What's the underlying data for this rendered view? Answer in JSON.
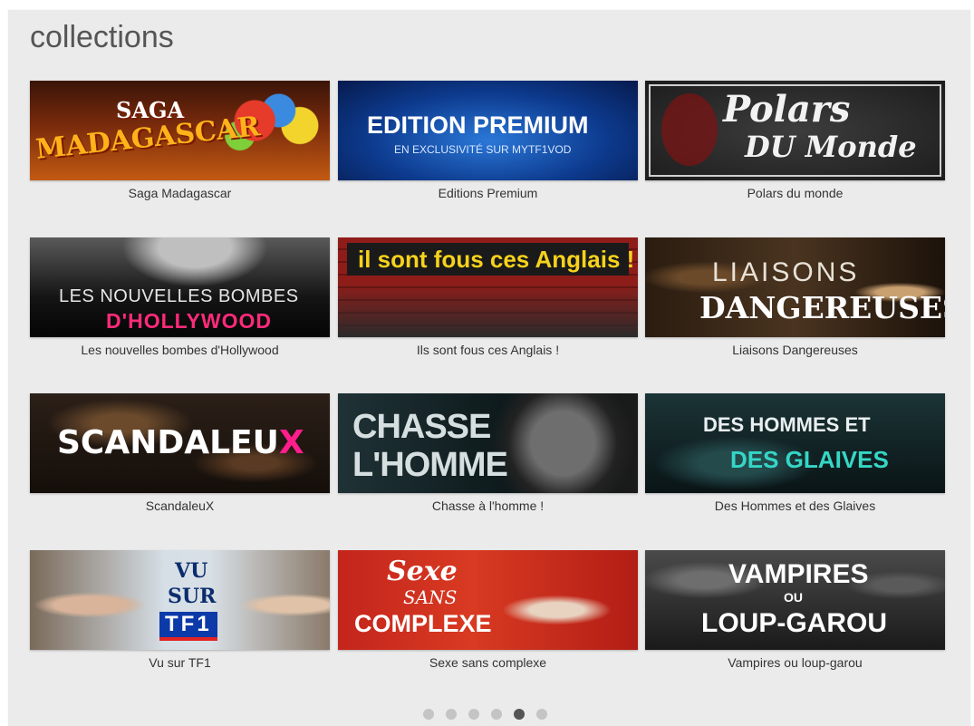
{
  "page": {
    "title": "collections"
  },
  "collections": [
    {
      "caption": "Saga Madagascar",
      "banner_lines": [
        "SAGA",
        "MADAGASCAR"
      ]
    },
    {
      "caption": "Editions Premium",
      "banner_lines": [
        "EDITION PREMIUM",
        "EN EXCLUSIVITÉ SUR MYTF1VOD"
      ]
    },
    {
      "caption": "Polars du monde",
      "banner_lines": [
        "Polars",
        "DU Monde"
      ]
    },
    {
      "caption": "Les nouvelles bombes d'Hollywood",
      "banner_lines": [
        "LES NOUVELLES BOMBES",
        "D'HOLLYWOOD"
      ]
    },
    {
      "caption": "Ils sont fous ces Anglais !",
      "banner_lines": [
        "il sont fous ces Anglais !"
      ]
    },
    {
      "caption": "Liaisons Dangereuses",
      "banner_lines": [
        "LIAISONS",
        "DANGEREUSES"
      ]
    },
    {
      "caption": "ScandaleuX",
      "banner_lines": [
        "SCANDALEU",
        "X"
      ]
    },
    {
      "caption": "Chasse à l'homme !",
      "banner_lines": [
        "CHASSE",
        "L'HOMME"
      ]
    },
    {
      "caption": "Des Hommes et des Glaives",
      "banner_lines": [
        "DES HOMMES ET",
        "DES GLAIVES"
      ]
    },
    {
      "caption": "Vu sur TF1",
      "banner_lines": [
        "VU",
        "SUR",
        "TF1"
      ]
    },
    {
      "caption": "Sexe sans complexe",
      "banner_lines": [
        "Sexe",
        "SANS",
        "COMPLEXE"
      ]
    },
    {
      "caption": "Vampires ou loup-garou",
      "banner_lines": [
        "VAMPIRES",
        "OU",
        "LOUP-GAROU"
      ]
    }
  ],
  "pager": {
    "total_pages": 6,
    "current_page": 5
  }
}
